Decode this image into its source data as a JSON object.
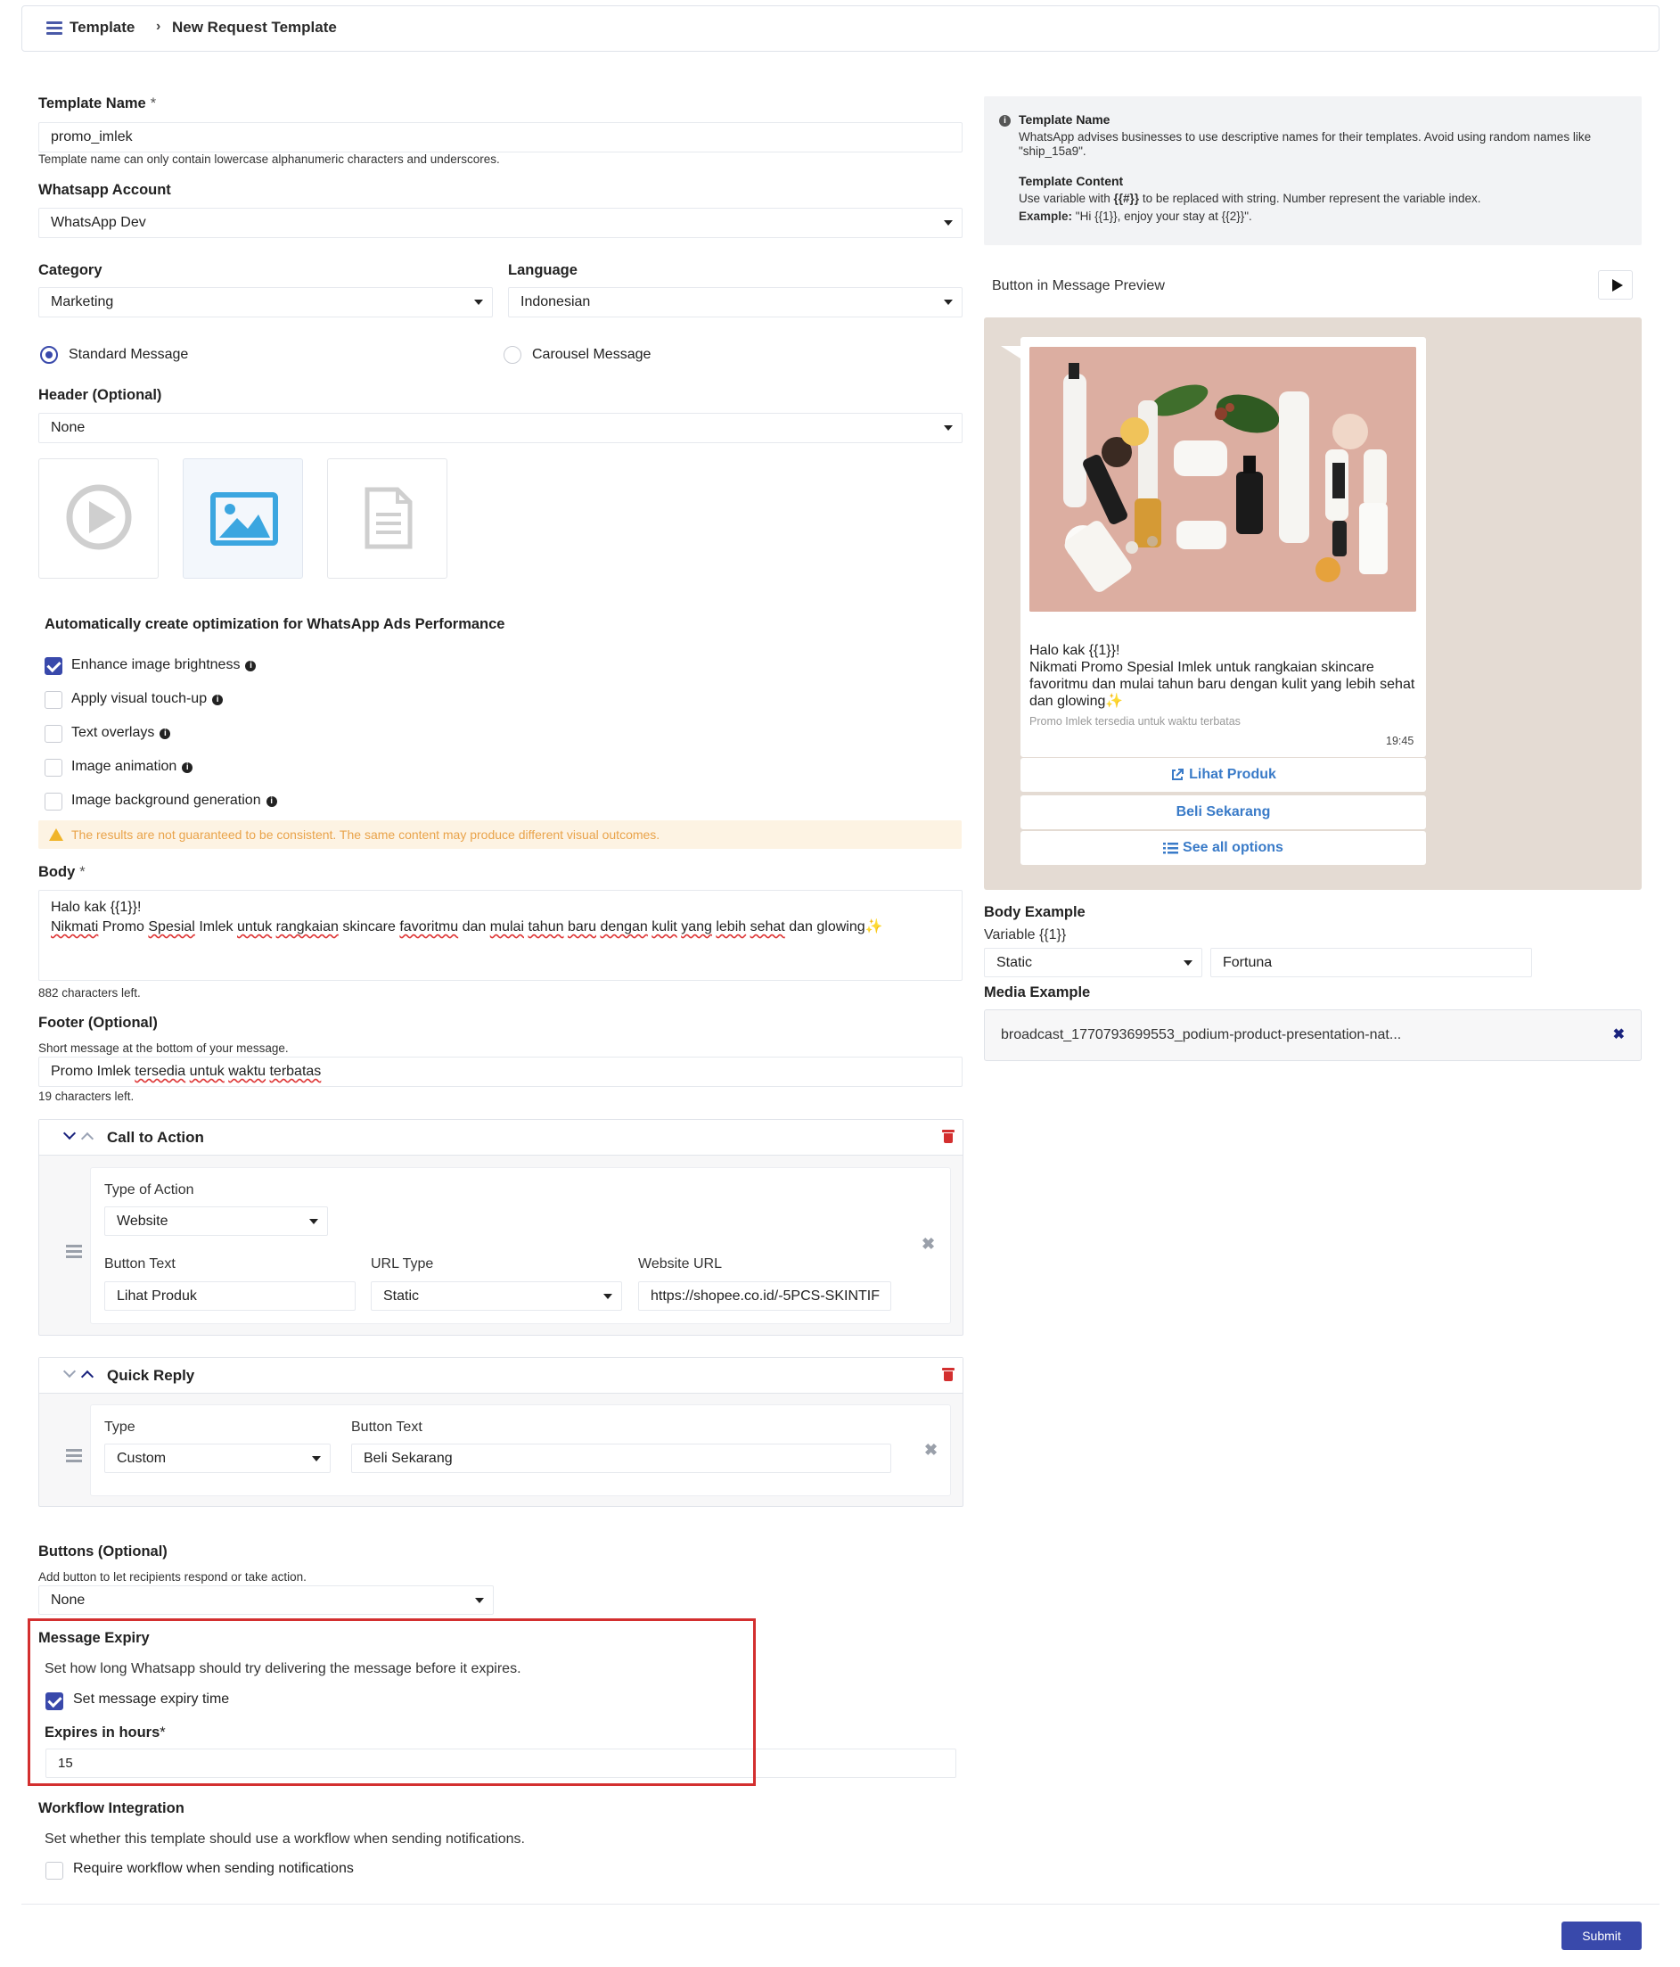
{
  "breadcrumb": {
    "root": "Template",
    "separator": "›",
    "current": "New Request Template"
  },
  "form": {
    "template_name": {
      "label": "Template Name",
      "required_mark": "*",
      "value": "promo_imlek",
      "hint": "Template name can only contain lowercase alphanumeric characters and underscores."
    },
    "whatsapp_account": {
      "label": "Whatsapp Account",
      "value": "WhatsApp Dev"
    },
    "category": {
      "label": "Category",
      "value": "Marketing"
    },
    "language": {
      "label": "Language",
      "value": "Indonesian"
    },
    "message_type": {
      "standard": "Standard Message",
      "carousel": "Carousel Message",
      "selected": "standard"
    },
    "header": {
      "label": "Header (Optional)",
      "value": "None",
      "media_selected": "image"
    },
    "optimization": {
      "title": "Automatically create optimization for WhatsApp Ads Performance",
      "options": [
        {
          "label": "Enhance image brightness",
          "checked": true
        },
        {
          "label": "Apply visual touch-up",
          "checked": false
        },
        {
          "label": "Text overlays",
          "checked": false
        },
        {
          "label": "Image animation",
          "checked": false
        },
        {
          "label": "Image background generation",
          "checked": false
        }
      ],
      "warning": "The results are not guaranteed to be consistent. The same content may produce different visual outcomes."
    },
    "body": {
      "label": "Body",
      "required_mark": "*",
      "line1": "Halo kak {{1}}!",
      "line2_words": [
        "Nikmati",
        "Promo",
        "Spesial",
        "Imlek",
        "untuk",
        "rangkaian",
        "skincare",
        "favoritmu",
        "dan",
        "mulai",
        "tahun",
        "baru",
        "dengan",
        "kulit",
        "yang",
        "lebih",
        "sehat",
        "dan",
        "glowing"
      ],
      "emoji": "✨",
      "chars_left": "882 characters left."
    },
    "footer": {
      "label": "Footer (Optional)",
      "hint": "Short message at the bottom of your message.",
      "words": [
        "Promo",
        "Imlek",
        "tersedia",
        "untuk",
        "waktu",
        "terbatas"
      ],
      "chars_left": "19 characters left."
    },
    "cta": {
      "title": "Call to Action",
      "type_label": "Type of Action",
      "type_value": "Website",
      "button_text_label": "Button Text",
      "button_text_value": "Lihat Produk",
      "url_type_label": "URL Type",
      "url_type_value": "Static",
      "website_url_label": "Website URL",
      "website_url_value": "https://shopee.co.id/-5PCS-SKINTIF"
    },
    "quick_reply": {
      "title": "Quick Reply",
      "type_label": "Type",
      "type_value": "Custom",
      "button_text_label": "Button Text",
      "button_text_value": "Beli Sekarang"
    },
    "buttons": {
      "label": "Buttons (Optional)",
      "hint": "Add button to let recipients respond or take action.",
      "value": "None"
    },
    "message_expiry": {
      "label": "Message Expiry",
      "desc": "Set how long Whatsapp should try delivering the message before it expires.",
      "checkbox": "Set message expiry time",
      "checked": true,
      "hours_label": "Expires in hours",
      "hours_req": "*",
      "hours_value": "15"
    },
    "workflow": {
      "label": "Workflow Integration",
      "desc": "Set whether this template should use a workflow when sending notifications.",
      "checkbox": "Require workflow when sending notifications",
      "checked": false
    },
    "submit": "Submit"
  },
  "tips": {
    "name_title": "Template Name",
    "name_text": "WhatsApp advises businesses to use descriptive names for their templates. Avoid using random names like \"ship_15a9\".",
    "content_title": "Template Content",
    "content_text_pre": "Use variable with ",
    "content_var": "{{#}}",
    "content_text_post": " to be replaced with string. Number represent the variable index.",
    "example_label": "Example:",
    "example_text": " \"Hi {{1}}, enjoy your stay at {{2}}\"."
  },
  "preview": {
    "label": "Button in Message Preview",
    "greeting": "Halo kak {{1}}!",
    "message": "Nikmati Promo Spesial Imlek untuk rangkaian skincare favoritmu dan mulai tahun baru dengan kulit yang lebih sehat dan glowing",
    "emoji": "✨",
    "footer": "Promo Imlek tersedia untuk waktu terbatas",
    "time": "19:45",
    "buttons": [
      "Lihat Produk",
      "Beli Sekarang",
      "See all options"
    ]
  },
  "body_example": {
    "label": "Body Example",
    "variable_label": "Variable {{1}}",
    "type_value": "Static",
    "value": "Fortuna"
  },
  "media_example": {
    "label": "Media Example",
    "filename": "broadcast_1770793699553_podium-product-presentation-nat..."
  },
  "colors": {
    "primary": "#3949ab",
    "danger": "#d32f2f",
    "link": "#3a7bc8",
    "warning_bg": "#fdf3e3",
    "warning_text": "#e9a34a",
    "preview_bg": "#e4dbd3"
  }
}
